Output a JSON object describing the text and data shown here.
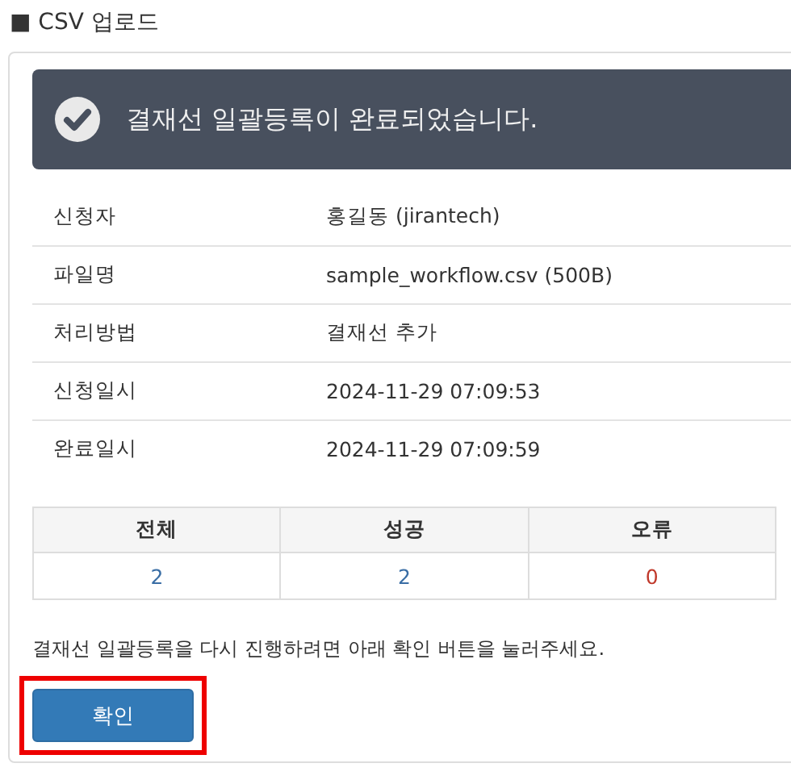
{
  "section_title": "■ CSV 업로드",
  "banner": {
    "message": "결재선 일괄등록이 완료되었습니다."
  },
  "details": [
    {
      "label": "신청자",
      "value": "홍길동 (jirantech)"
    },
    {
      "label": "파일명",
      "value": "sample_workflow.csv (500B)"
    },
    {
      "label": "처리방법",
      "value": "결재선 추가"
    },
    {
      "label": "신청일시",
      "value": "2024-11-29 07:09:53"
    },
    {
      "label": "완료일시",
      "value": "2024-11-29 07:09:59"
    }
  ],
  "summary": {
    "columns": [
      "전체",
      "성공",
      "오류"
    ],
    "counts": [
      {
        "value": "2",
        "color": "#3a6ea5"
      },
      {
        "value": "2",
        "color": "#3a6ea5"
      },
      {
        "value": "0",
        "color": "#c0392b"
      }
    ]
  },
  "note": "결재선 일괄등록을 다시 진행하려면 아래 확인 버튼을 눌러주세요.",
  "confirm_button": {
    "label": "확인",
    "highlighted": true
  }
}
